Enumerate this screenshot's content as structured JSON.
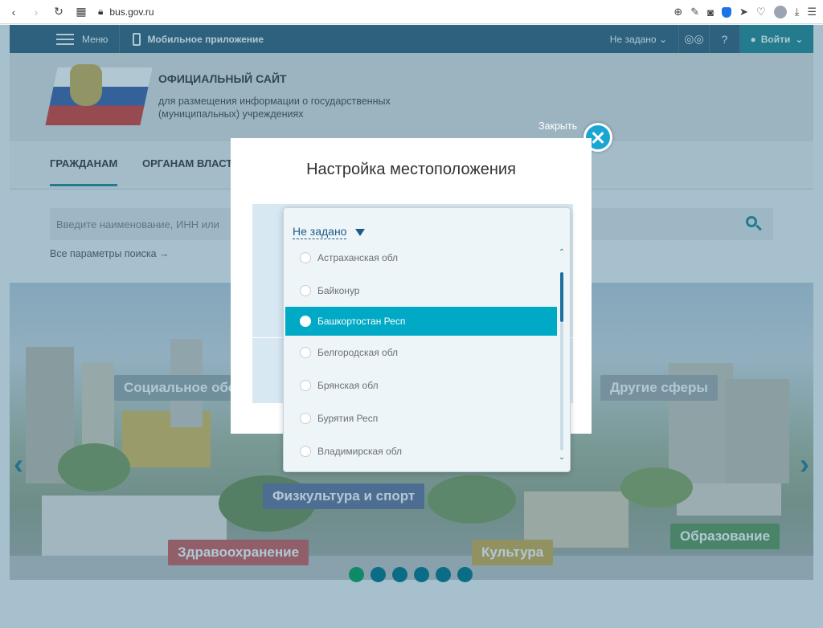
{
  "browser": {
    "url": "bus.gov.ru"
  },
  "topbar": {
    "menu_label": "Меню",
    "mobile_label": "Мобильное приложение",
    "region_label": "Не задано",
    "login_label": "Войти"
  },
  "header": {
    "title": "ОФИЦИАЛЬНЫЙ САЙТ",
    "subtitle": "для размещения информации о государственных (муниципальных) учреждениях"
  },
  "tabs": [
    {
      "label": "ГРАЖДАНАМ"
    },
    {
      "label": "ОРГАНАМ ВЛАСТИ"
    }
  ],
  "search": {
    "placeholder": "Введите наименование, ИНН или",
    "all_params": "Все параметры поиска →"
  },
  "banner": {
    "labels": {
      "social": "Социальное обс",
      "other": "Другие сферы",
      "sport": "Физкультура и спорт",
      "education": "Образование",
      "health": "Здравоохранение",
      "culture": "Культура"
    },
    "slides_count": 6,
    "active_slide": 1
  },
  "modal": {
    "close_label": "Закрыть",
    "title": "Настройка местоположения"
  },
  "dropdown": {
    "selected": "Не задано",
    "items": [
      {
        "label": "Астраханская обл",
        "selected": false
      },
      {
        "label": "Байконур",
        "selected": false
      },
      {
        "label": "Башкортостан Респ",
        "selected": true
      },
      {
        "label": "Белгородская обл",
        "selected": false
      },
      {
        "label": "Брянская обл",
        "selected": false
      },
      {
        "label": "Бурятия Респ",
        "selected": false
      },
      {
        "label": "Владимирская обл",
        "selected": false
      }
    ]
  },
  "colors": {
    "accent": "#00a9c6",
    "primary_dark": "#1d4e6b",
    "login_bg": "#0c7a87"
  }
}
